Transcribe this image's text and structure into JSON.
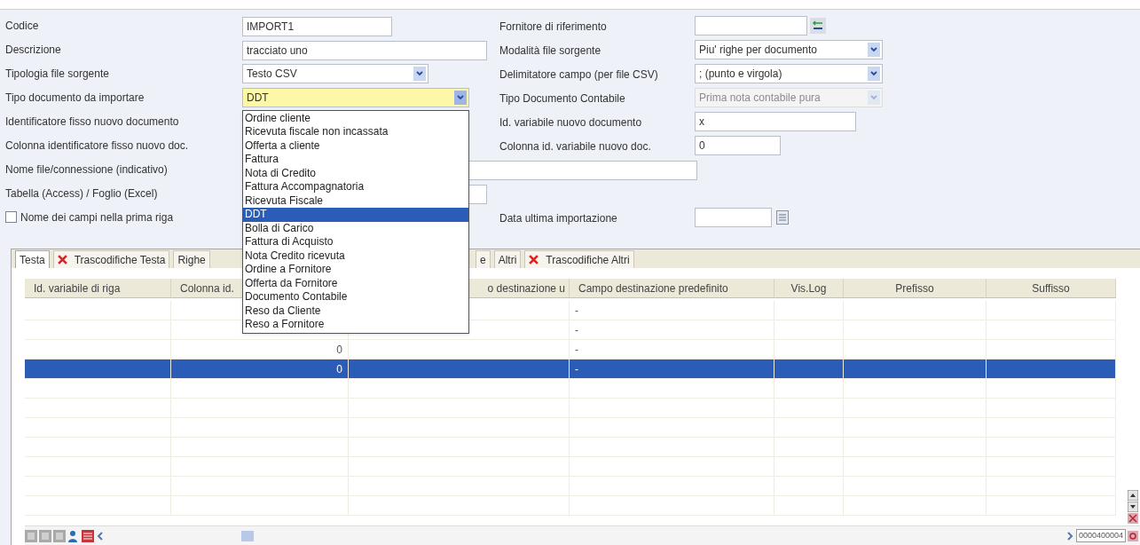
{
  "form": {
    "rows": [
      {
        "left": {
          "label": "Codice",
          "kind": "input",
          "value": "IMPORT1"
        },
        "right": {
          "label": "Fornitore di riferimento",
          "kind": "lookup"
        }
      },
      {
        "left": {
          "label": "Descrizione",
          "kind": "input",
          "value": "tracciato uno"
        },
        "right": {
          "label": "Modalità file sorgente",
          "kind": "select",
          "value": "Piu' righe per documento",
          "disabled": false
        }
      },
      {
        "left": {
          "label": "Tipologia file sorgente",
          "kind": "select",
          "value": "Testo CSV",
          "focused": false,
          "expanded": false
        },
        "right": {
          "label": "Delimitatore campo (per file CSV)",
          "kind": "select",
          "value": "; (punto e virgola)",
          "disabled": false
        }
      },
      {
        "left": {
          "label": "Tipo documento da importare",
          "kind": "select",
          "value": "DDT",
          "focused": true,
          "expanded": true
        },
        "right": {
          "label": "Tipo Documento Contabile",
          "kind": "select",
          "value": "Prima nota contabile pura",
          "disabled": true
        }
      },
      {
        "left": {
          "label": "Identificatore fisso nuovo documento",
          "kind": "hidden"
        },
        "right": {
          "label": "Id. variabile nuovo documento",
          "kind": "input",
          "value": "x"
        }
      },
      {
        "left": {
          "label": "Colonna identificatore fisso nuovo doc.",
          "kind": "hidden"
        },
        "right": {
          "label": "Colonna id. variabile nuovo doc.",
          "kind": "input",
          "value": "0"
        }
      },
      {
        "left": {
          "label": "Nome file/connessione (indicativo)",
          "kind": "input"
        }
      },
      {
        "left": {
          "label": "Tabella (Access) / Foglio (Excel)",
          "kind": "input"
        }
      },
      {
        "left": {
          "label": "Nome dei campi nella prima riga",
          "kind": "checkbox",
          "checked": false
        },
        "right": {
          "label": "Data ultima importazione",
          "kind": "date"
        }
      }
    ]
  },
  "dropdown": [
    {
      "label": "Ordine cliente",
      "selected": false
    },
    {
      "label": "Ricevuta fiscale non incassata",
      "selected": false
    },
    {
      "label": "Offerta a cliente",
      "selected": false
    },
    {
      "label": "Fattura",
      "selected": false
    },
    {
      "label": "Nota di Credito",
      "selected": false
    },
    {
      "label": "Fattura Accompagnatoria",
      "selected": false
    },
    {
      "label": "Ricevuta Fiscale",
      "selected": false
    },
    {
      "label": "DDT",
      "selected": true
    },
    {
      "label": "Bolla di Carico",
      "selected": false
    },
    {
      "label": "Fattura di Acquisto",
      "selected": false
    },
    {
      "label": "Nota Credito ricevuta",
      "selected": false
    },
    {
      "label": "Ordine a Fornitore",
      "selected": false
    },
    {
      "label": "Offerta da Fornitore",
      "selected": false
    },
    {
      "label": "Documento Contabile",
      "selected": false
    },
    {
      "label": "Reso da Cliente",
      "selected": false
    },
    {
      "label": "Reso a Fornitore",
      "selected": false
    }
  ],
  "tabs": [
    {
      "label": "Testa",
      "selected": true,
      "error": false
    },
    {
      "label": "Trascodifiche Testa",
      "selected": false,
      "error": true
    },
    {
      "label": "Righe",
      "selected": false,
      "error": false
    },
    {
      "label": "e",
      "selected": false,
      "error": false
    },
    {
      "label": "Altri",
      "selected": false,
      "error": false
    },
    {
      "label": "Trascodifiche Altri",
      "selected": false,
      "error": true
    }
  ],
  "table": {
    "columns": [
      "Id. variabile di riga",
      "Colonna id.",
      "o destinazione u",
      "Campo destinazione predefinito",
      "Vis.Log",
      "Prefisso",
      "Suffisso"
    ],
    "rows": [
      {
        "selected": false,
        "cells": {
          "3": "-"
        }
      },
      {
        "selected": false,
        "cells": {
          "3": "-"
        }
      },
      {
        "selected": false,
        "cells": {
          "1": "0",
          "3": "-"
        }
      },
      {
        "selected": true,
        "cells": {
          "1": "0",
          "3": "-"
        }
      }
    ]
  },
  "record_number": "0000400004"
}
